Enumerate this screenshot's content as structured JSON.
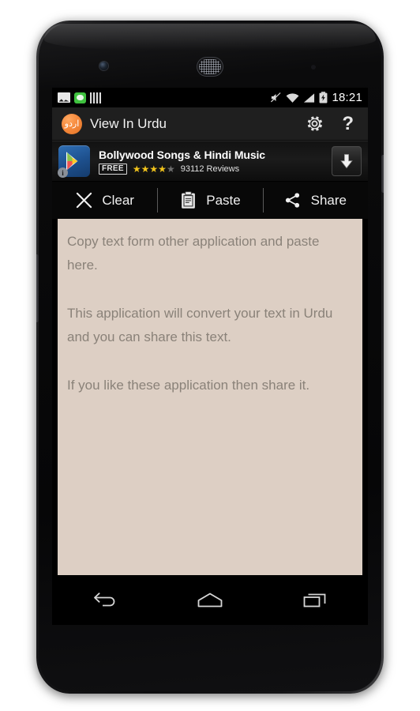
{
  "status_bar": {
    "time": "18:21",
    "left_icons": [
      {
        "name": "photo-icon",
        "label": "screenshot"
      },
      {
        "name": "chat-icon",
        "label": "messaging"
      },
      {
        "name": "bars-icon",
        "label": "app-notification"
      }
    ],
    "right_icons": [
      {
        "name": "mute-icon",
        "label": "silent mode"
      },
      {
        "name": "wifi-icon",
        "label": "wifi"
      },
      {
        "name": "signal-icon",
        "label": "cellular signal"
      },
      {
        "name": "battery-charging-icon",
        "label": "battery charging"
      }
    ]
  },
  "action_bar": {
    "app_icon_text": "اردو",
    "title": "View In Urdu",
    "settings_icon": "gear-icon",
    "help_label": "?"
  },
  "ad": {
    "title": "Bollywood Songs & Hindi Music",
    "price_badge": "FREE",
    "rating": 4,
    "rating_max": 5,
    "reviews": "93112 Reviews",
    "store_icon": "google-play-icon",
    "info_badge": "i",
    "download_icon": "download-arrow-icon"
  },
  "toolbar": {
    "buttons": [
      {
        "name": "clear",
        "label": "Clear",
        "icon": "close-x-icon"
      },
      {
        "name": "paste",
        "label": "Paste",
        "icon": "clipboard-icon"
      },
      {
        "name": "share",
        "label": "Share",
        "icon": "share-icon"
      }
    ]
  },
  "editor": {
    "hint_text": "Copy text form other application and paste here.\n\nThis application will convert your text in Urdu and you can share this text.\n\nIf you like these application then share it."
  },
  "nav_bar": {
    "buttons": [
      {
        "name": "back",
        "icon": "back-arrow-icon"
      },
      {
        "name": "home",
        "icon": "home-icon"
      },
      {
        "name": "recents",
        "icon": "recent-apps-icon"
      }
    ]
  },
  "colors": {
    "editor_bg": "#ddcfc4",
    "editor_text": "#8a8279",
    "action_bar_bg": "#1f1f1f",
    "app_icon_accent": "#f5883b",
    "star_on": "#f2c41c",
    "star_off": "#6e6e6e"
  }
}
